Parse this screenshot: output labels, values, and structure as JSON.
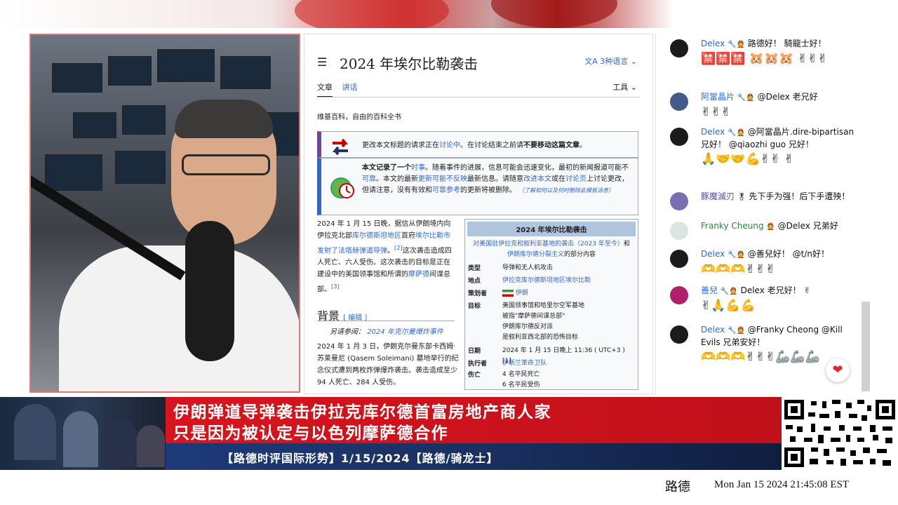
{
  "wiki": {
    "title": "2024 年埃尔比勒袭击",
    "languages": "3种语言",
    "tabs": [
      "文章",
      "讲话"
    ],
    "tools": "工具",
    "tagline": "维基百科，自由的百科全书",
    "notice_rename_pre": "更改本文标题的请求正在",
    "notice_rename_link": "讨论中",
    "notice_rename_post": "。在讨论结束之前请",
    "notice_rename_bold": "不要移动这篇文章",
    "notice_rename_end": "。",
    "notice_current_bold": "本文记录了一个",
    "notice_current_link": "时事",
    "notice_current_rest": "。随着事件的进展，信息可能会迅速变化，最初的新闻报道可能不",
    "notice_current_link2": "可靠",
    "notice_current_rest2": "。本文的最新",
    "notice_current_link3": "更新可能不反映",
    "notice_current_rest3": "最新信息。请随意",
    "notice_current_link4": "改进本文",
    "notice_current_rest4": "或在",
    "notice_current_link5": "讨论页",
    "notice_current_rest5": "上讨论更改，但请注意，没有有效和",
    "notice_current_link6": "可靠参考",
    "notice_current_rest6": "的更新将被删除。",
    "notice_current_small": "（了解如何以及何时删除此模板消息）",
    "lead_1": "2024 年 1 月 15 日晚，据信从伊朗境内向伊拉克北部",
    "lead_link1": "库尔德斯坦地区",
    "lead_2": "首府",
    "lead_link2": "埃尔比勒市发射了法塔赫弹道导弹",
    "lead_3": "。",
    "lead_ref1": "[2]",
    "lead_4": "这次袭击造成四人死亡、六人受伤。这次袭击的目标是正在建设中的美国领事馆和所谓的",
    "lead_link3": "摩萨德",
    "lead_5": "间谍总部。",
    "lead_ref2": "[3]",
    "section_title": "背景",
    "section_edit": "[ 编辑 ]",
    "see_also_label": "另请参阅：",
    "see_also_link": "2024 年克尔曼爆炸事件",
    "section_text": "2024 年 1 月 3 日，伊朗克尔曼东部卡西姆·苏莱曼尼 (Qasem Soleimani) 墓地举行的纪念仪式遭到两枚炸弹爆炸袭击。袭击造成至少 94 人死亡、284 人受伤。"
  },
  "infobox": {
    "title": "2024 年埃尔比勒袭击",
    "sub_link1": "对美国驻伊拉克和叙利亚基地的袭击（2023 年至今）",
    "sub_and": "和",
    "sub_link2": "伊朗库尔德分裂主义",
    "sub_end": "的部分内容",
    "rows": [
      {
        "label": "类型",
        "value": "导弹和无人机攻击"
      },
      {
        "label": "地点",
        "value": "伊拉克库尔德斯坦地区埃尔比勒"
      },
      {
        "label": "策划者",
        "value": "伊朗"
      },
      {
        "label": "目标",
        "value": "美国领事馆和哈里尔空军基地\n被指\"摩萨德间谍总部\"\n伊朗库尔德反对派\n是叙利亚西北部的恐怖目标"
      },
      {
        "label": "日期",
        "value": "2024 年 1 月 15 日晚上 11:36 ( UTC+3 ) [1]"
      },
      {
        "label": "执行者",
        "value": "伊斯兰革命卫队"
      },
      {
        "label": "伤亡",
        "value": "4 名平民死亡\n6 名平民受伤"
      }
    ]
  },
  "chat": {
    "messages": [
      {
        "author": "Delex",
        "text": "路德好！ 騎龍士好！",
        "emotes": "🈲🈲🈲 🐹🐹🐹 ✌✌✌"
      },
      {
        "author": "阿當晶片",
        "text": "@Delex 老兄好",
        "emotes": "✌✌✌"
      },
      {
        "author": "Delex",
        "text": "@阿當晶片.dire-bipartisan兄好！ @qiaozhi guo 兄好！",
        "emotes": "🙏🤝🤝💪✌✌ ✌"
      },
      {
        "author": "豚魔滅刃",
        "text": "先下手为强！后下手遭殃！",
        "emotes": ""
      },
      {
        "author": "Franky Cheung",
        "text": "@Delex 兄弟好",
        "emotes": ""
      },
      {
        "author": "Delex",
        "text": "@善兒好！ @t/n好！",
        "emotes": "🫶🫶🫶✌✌✌"
      },
      {
        "author": "善兒",
        "text": "Delex 老兄好！ ✌",
        "emotes": "✌🙏💪💪"
      },
      {
        "author": "Delex",
        "text": "@Franky Cheong @Kill Evils 兄弟安好！",
        "emotes": "🫶🫶🫶✌✌✌🦾🦾🦾"
      }
    ]
  },
  "lower_third": {
    "headline_1": "伊朗弹道导弹袭击伊拉克库尔德首富房地产商人家",
    "headline_2": "只是因为被认定与以色列摩萨德合作",
    "subline": "【路德时评国际形势】1/15/2024【路德/骑龙士】"
  },
  "footer": {
    "brand": "路德",
    "clock": "Mon Jan 15 2024 21:45:08 EST"
  },
  "icons": {
    "menu": "list-icon",
    "translate": "translate-icon",
    "heart": "heart-icon"
  },
  "colors": {
    "red_band": "#d8141e",
    "blue_band": "#1d3a78",
    "wiki_link": "#3366cc"
  }
}
